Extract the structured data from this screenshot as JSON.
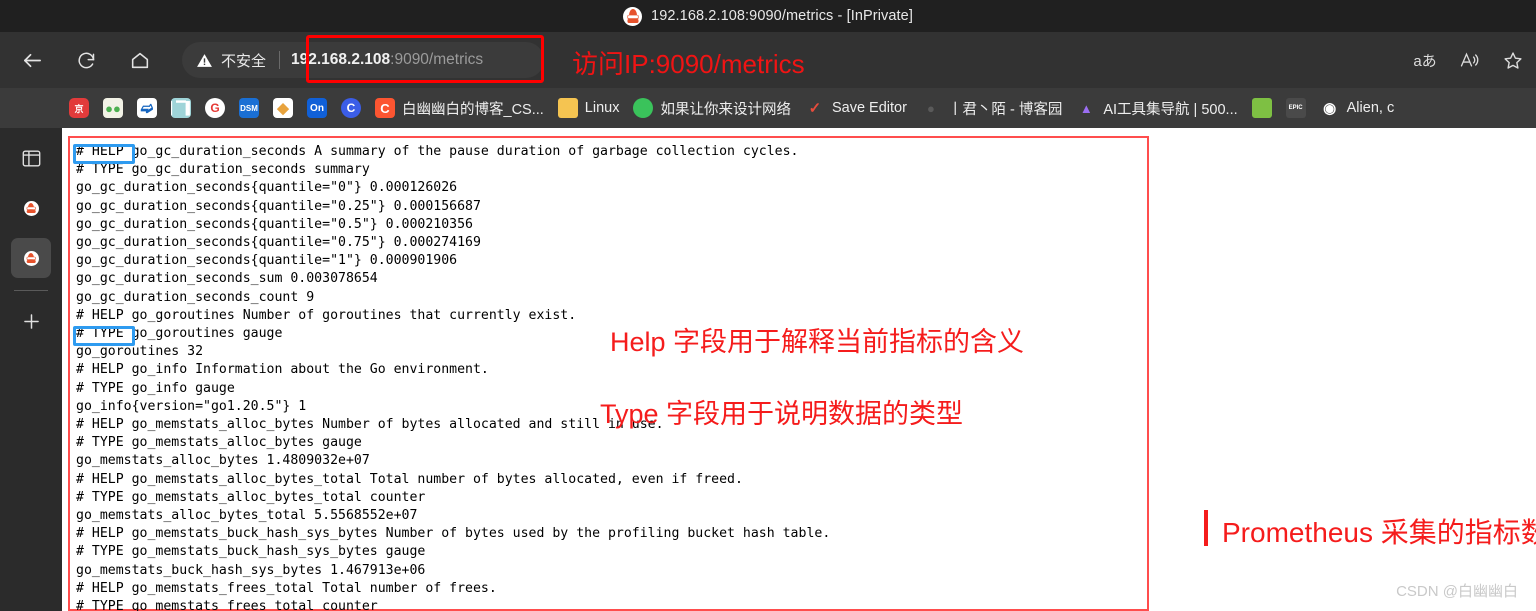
{
  "window": {
    "title": "192.168.2.108:9090/metrics - [InPrivate]",
    "favicon": "prometheus-icon"
  },
  "toolbar": {
    "back_icon": "back-arrow-icon",
    "reload_icon": "reload-icon",
    "home_icon": "home-icon",
    "security_label": "不安全",
    "security_icon": "warning-triangle-icon",
    "url_host": "192.168.2.108",
    "url_rest": ":9090/metrics",
    "url_full": "192.168.2.108:9090/metrics",
    "annotation": "访问IP:9090/metrics",
    "right_icons": [
      {
        "name": "translate-icon",
        "glyph": "aあ"
      },
      {
        "name": "read-aloud-icon",
        "glyph": "A"
      },
      {
        "name": "favorites-star-icon",
        "glyph": "☆"
      }
    ]
  },
  "bookmarks": [
    {
      "label": "",
      "icon": "jd-icon",
      "color": "#e23b3b",
      "text": "京"
    },
    {
      "label": "",
      "icon": "frog-icon",
      "color": "#f2f2e6",
      "text": "🐸"
    },
    {
      "label": "",
      "icon": "blue-arrow-icon",
      "color": "#ffffff",
      "text": "≥"
    },
    {
      "label": "",
      "icon": "waveform-icon",
      "color": "#9fd4d8",
      "text": "⁞⁞"
    },
    {
      "label": "",
      "icon": "g-circle-icon",
      "color": "#ffffff",
      "text": "G"
    },
    {
      "label": "",
      "icon": "dsm-icon",
      "color": "#1a6fd4",
      "text": "DSM"
    },
    {
      "label": "",
      "icon": "origami-icon",
      "color": "#ffffff",
      "text": "◆"
    },
    {
      "label": "",
      "icon": "on-icon",
      "color": "#1060d8",
      "text": "On"
    },
    {
      "label": "",
      "icon": "c-circle-icon",
      "color": "#3b5de7",
      "text": "C"
    },
    {
      "label": "白幽幽白的博客_CS...",
      "icon": "csdn-icon",
      "color": "#fc5531",
      "text": "C"
    },
    {
      "label": "Linux",
      "icon": "folder-icon",
      "color": "#f5c451",
      "text": ""
    },
    {
      "label": "如果让你来设计网络",
      "icon": "wechat-icon",
      "color": "#3ac35b",
      "text": ""
    },
    {
      "label": "Save Editor",
      "icon": "save-editor-icon",
      "color": "#2b2b2b",
      "text": "✓"
    },
    {
      "label": "丨君丶陌 - 博客园",
      "icon": "cnblogs-icon",
      "color": "#3b3b3b",
      "text": ""
    },
    {
      "label": "AI工具集导航 | 500...",
      "icon": "ai-nav-icon",
      "color": "#3b3b3b",
      "text": "▲"
    },
    {
      "label": "",
      "icon": "squares-icon",
      "color": "#7ec043",
      "text": ""
    },
    {
      "label": "",
      "icon": "epic-games-icon",
      "color": "#3b3b3b",
      "text": "EPIC"
    },
    {
      "label": "Alien, c",
      "icon": "eye-icon",
      "color": "#3b3b3b",
      "text": "◉"
    }
  ],
  "rail": {
    "items": [
      {
        "name": "tab-list-icon",
        "selected": false
      },
      {
        "name": "prometheus-tab-1",
        "selected": false
      },
      {
        "name": "prometheus-tab-2",
        "selected": true
      },
      {
        "name": "new-tab-button",
        "selected": false
      }
    ]
  },
  "page": {
    "metrics_text": "# HELP go_gc_duration_seconds A summary of the pause duration of garbage collection cycles.\n# TYPE go_gc_duration_seconds summary\ngo_gc_duration_seconds{quantile=\"0\"} 0.000126026\ngo_gc_duration_seconds{quantile=\"0.25\"} 0.000156687\ngo_gc_duration_seconds{quantile=\"0.5\"} 0.000210356\ngo_gc_duration_seconds{quantile=\"0.75\"} 0.000274169\ngo_gc_duration_seconds{quantile=\"1\"} 0.000901906\ngo_gc_duration_seconds_sum 0.003078654\ngo_gc_duration_seconds_count 9\n# HELP go_goroutines Number of goroutines that currently exist.\n# TYPE go_goroutines gauge\ngo_goroutines 32\n# HELP go_info Information about the Go environment.\n# TYPE go_info gauge\ngo_info{version=\"go1.20.5\"} 1\n# HELP go_memstats_alloc_bytes Number of bytes allocated and still in use.\n# TYPE go_memstats_alloc_bytes gauge\ngo_memstats_alloc_bytes 1.4809032e+07\n# HELP go_memstats_alloc_bytes_total Total number of bytes allocated, even if freed.\n# TYPE go_memstats_alloc_bytes_total counter\ngo_memstats_alloc_bytes_total 5.5568552e+07\n# HELP go_memstats_buck_hash_sys_bytes Number of bytes used by the profiling bucket hash table.\n# TYPE go_memstats_buck_hash_sys_bytes gauge\ngo_memstats_buck_hash_sys_bytes 1.467913e+06\n# HELP go_memstats_frees_total Total number of frees.\n# TYPE go_memstats_frees_total counter",
    "annotations": {
      "help": "Help 字段用于解释当前指标的含义",
      "type": "Type 字段用于说明数据的类型",
      "prometheus": "Prometheus 采集的指标数据"
    },
    "highlight_labels": {
      "help": "# HELP",
      "type": "# TYPE"
    },
    "watermark": "CSDN @白幽幽白"
  },
  "colors": {
    "annotation_red": "#f51c1c",
    "highlight_blue": "#2e9bf0",
    "box_red": "#ff4d4d",
    "prometheus_orange": "#e6522c"
  }
}
